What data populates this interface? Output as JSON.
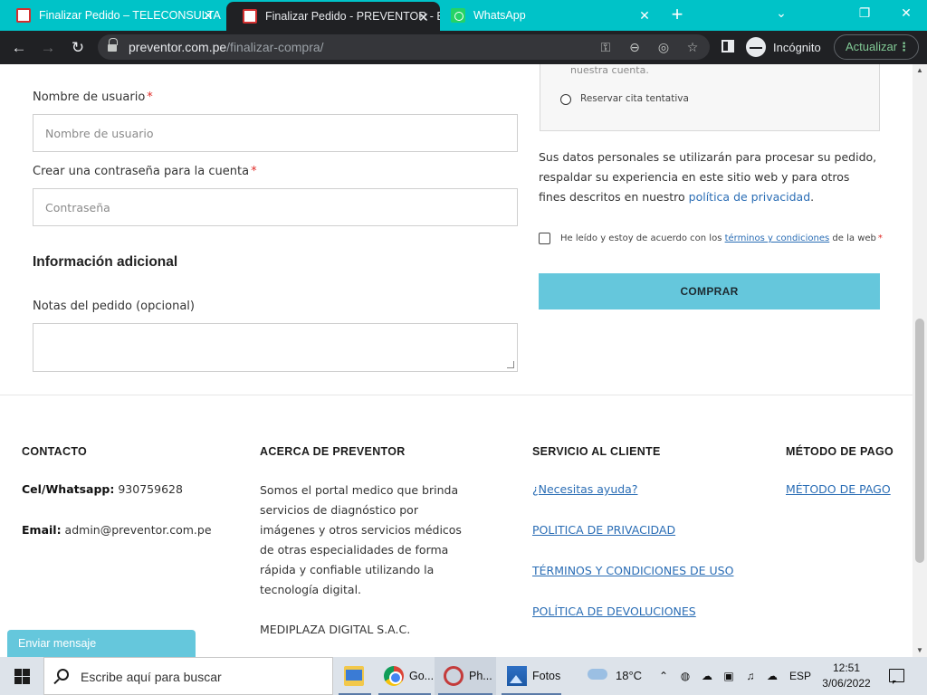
{
  "browser": {
    "tabs": [
      {
        "title": "Finalizar Pedido – TELECONSULTA",
        "close": "✕"
      },
      {
        "title": "Finalizar Pedido - PREVENTOR - E",
        "close": "✕"
      },
      {
        "title": "WhatsApp",
        "close": "✕"
      }
    ],
    "new_tab": "+",
    "window": {
      "minimize": "⌄",
      "restore": "❐",
      "close": "✕"
    },
    "url_domain": "preventor.com.pe",
    "url_path": "/finalizar-compra/",
    "incognito_label": "Incógnito",
    "update_label": "Actualizar"
  },
  "form": {
    "username_label": "Nombre de usuario",
    "username_placeholder": "Nombre de usuario",
    "password_label": "Crear una contraseña para la cuenta",
    "password_placeholder": "Contraseña",
    "required_mark": "*",
    "additional_heading": "Información adicional",
    "notes_label": "Notas del pedido (opcional)"
  },
  "payment": {
    "account_note": "nuestra cuenta.",
    "option_label": "Reservar cita tentativa",
    "privacy_text_1": "Sus datos personales se utilizarán para procesar su pedido, respaldar su experiencia en este sitio web y para otros fines descritos en nuestro ",
    "privacy_link": "política de privacidad",
    "privacy_text_2": ".",
    "terms_text_1": "He leído y estoy de acuerdo con los ",
    "terms_link": "términos y condiciones",
    "terms_text_2": " de la web",
    "buy_label": "COMPRAR"
  },
  "footer": {
    "contact_heading": "CONTACTO",
    "phone_label": "Cel/Whatsapp:",
    "phone_value": " 930759628",
    "email_label": "Email:",
    "email_value": " admin@preventor.com.pe",
    "about_heading": "ACERCA DE PREVENTOR",
    "about_text": "Somos el portal medico que brinda servicios de diagnóstico por imágenes y otros servicios médicos de otras especialidades de forma rápida y confiable utilizando la tecnología digital.",
    "company": "MEDIPLAZA DIGITAL S.A.C.",
    "service_heading": "SERVICIO AL CLIENTE",
    "service_links": [
      "¿Necesitas ayuda?",
      "POLITICA DE PRIVACIDAD",
      "TÉRMINOS Y CONDICIONES DE USO",
      "POLÍTICA DE DEVOLUCIONES"
    ],
    "payment_heading": "MÉTODO DE PAGO",
    "payment_link": "MÉTODO DE PAGO"
  },
  "chat": {
    "label": "Enviar mensaje"
  },
  "taskbar": {
    "search_placeholder": "Escribe aquí para buscar",
    "apps": [
      {
        "label": "",
        "icon": "file-explorer-icon"
      },
      {
        "label": "Go...",
        "icon": "chrome-icon"
      },
      {
        "label": "Ph...",
        "icon": "photopea-icon"
      },
      {
        "label": "Fotos",
        "icon": "photos-icon"
      }
    ],
    "weather": "18°C",
    "language": "ESP",
    "time": "12:51",
    "date": "3/06/2022"
  },
  "colors": {
    "tabstrip": "#00c3c8",
    "accent_button": "#65c7dc",
    "link": "#2a6db5",
    "required": "#e02b27"
  }
}
